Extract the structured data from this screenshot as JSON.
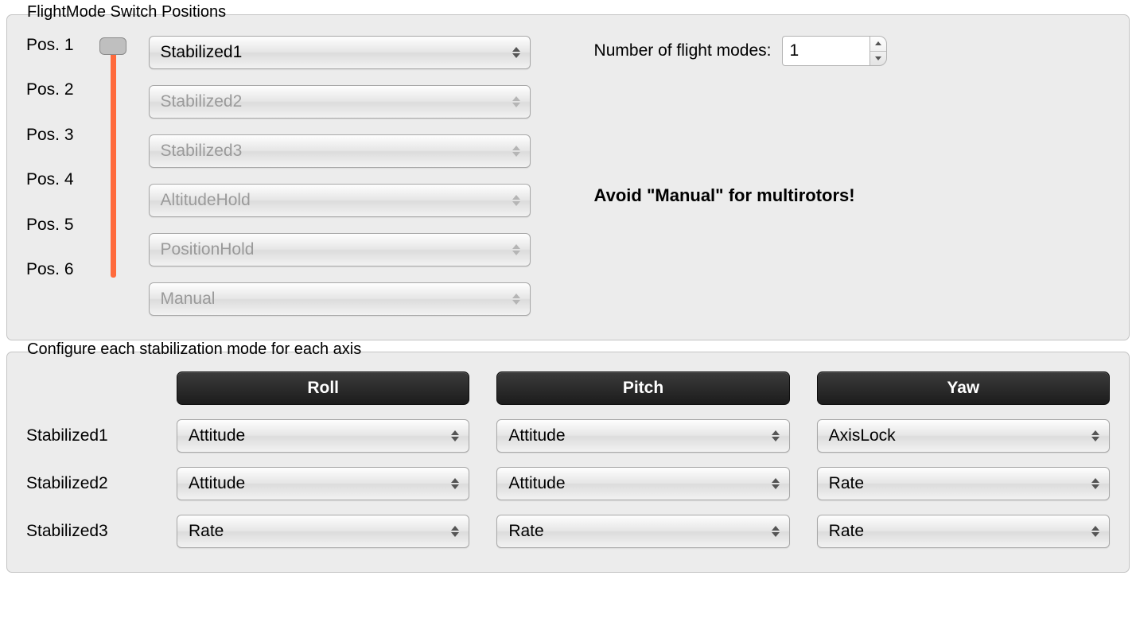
{
  "flightmode": {
    "title": "FlightMode Switch Positions",
    "positions": [
      {
        "label": "Pos. 1",
        "value": "Stabilized1",
        "enabled": true
      },
      {
        "label": "Pos. 2",
        "value": "Stabilized2",
        "enabled": false
      },
      {
        "label": "Pos. 3",
        "value": "Stabilized3",
        "enabled": false
      },
      {
        "label": "Pos. 4",
        "value": "AltitudeHold",
        "enabled": false
      },
      {
        "label": "Pos. 5",
        "value": "PositionHold",
        "enabled": false
      },
      {
        "label": "Pos. 6",
        "value": "Manual",
        "enabled": false
      }
    ],
    "num_modes_label": "Number of flight modes:",
    "num_modes_value": "1",
    "warning": "Avoid \"Manual\" for multirotors!"
  },
  "stab": {
    "title": "Configure each stabilization mode for each axis",
    "axes": [
      "Roll",
      "Pitch",
      "Yaw"
    ],
    "rows": [
      {
        "label": "Stabilized1",
        "roll": "Attitude",
        "pitch": "Attitude",
        "yaw": "AxisLock"
      },
      {
        "label": "Stabilized2",
        "roll": "Attitude",
        "pitch": "Attitude",
        "yaw": "Rate"
      },
      {
        "label": "Stabilized3",
        "roll": "Rate",
        "pitch": "Rate",
        "yaw": "Rate"
      }
    ]
  }
}
